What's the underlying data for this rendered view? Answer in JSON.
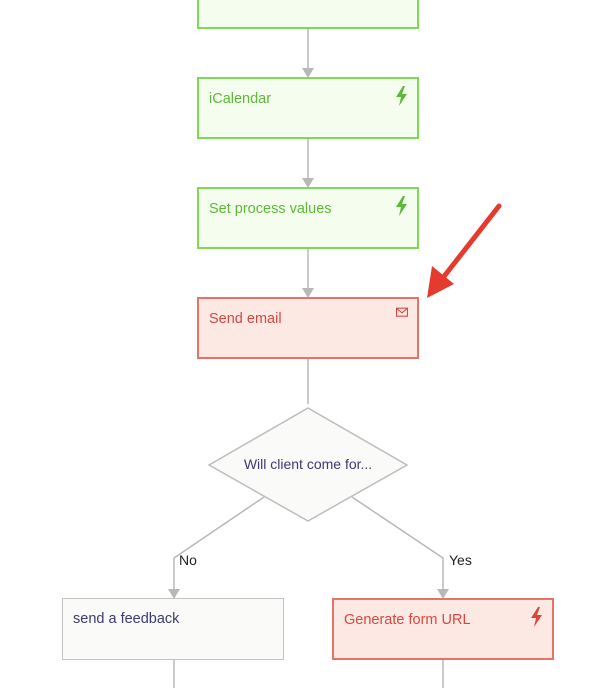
{
  "flow": {
    "nodes": {
      "top": {
        "label": ""
      },
      "icalendar": {
        "label": "iCalendar",
        "icon": "lightning-icon"
      },
      "set_process": {
        "label": "Set process values",
        "icon": "lightning-icon"
      },
      "send_email": {
        "label": "Send email",
        "icon": "mail-icon"
      },
      "decision": {
        "label": "Will client come for..."
      },
      "send_feedback": {
        "label": "send a feedback"
      },
      "generate_url": {
        "label": "Generate form URL",
        "icon": "lightning-icon"
      }
    },
    "branches": {
      "no": "No",
      "yes": "Yes"
    }
  },
  "colors": {
    "green_border": "#7ed957",
    "green_text": "#5cb838",
    "red_border": "#e57368",
    "red_text": "#d64841",
    "connector": "#b8b8b8",
    "arrow": "#e53b2f"
  }
}
